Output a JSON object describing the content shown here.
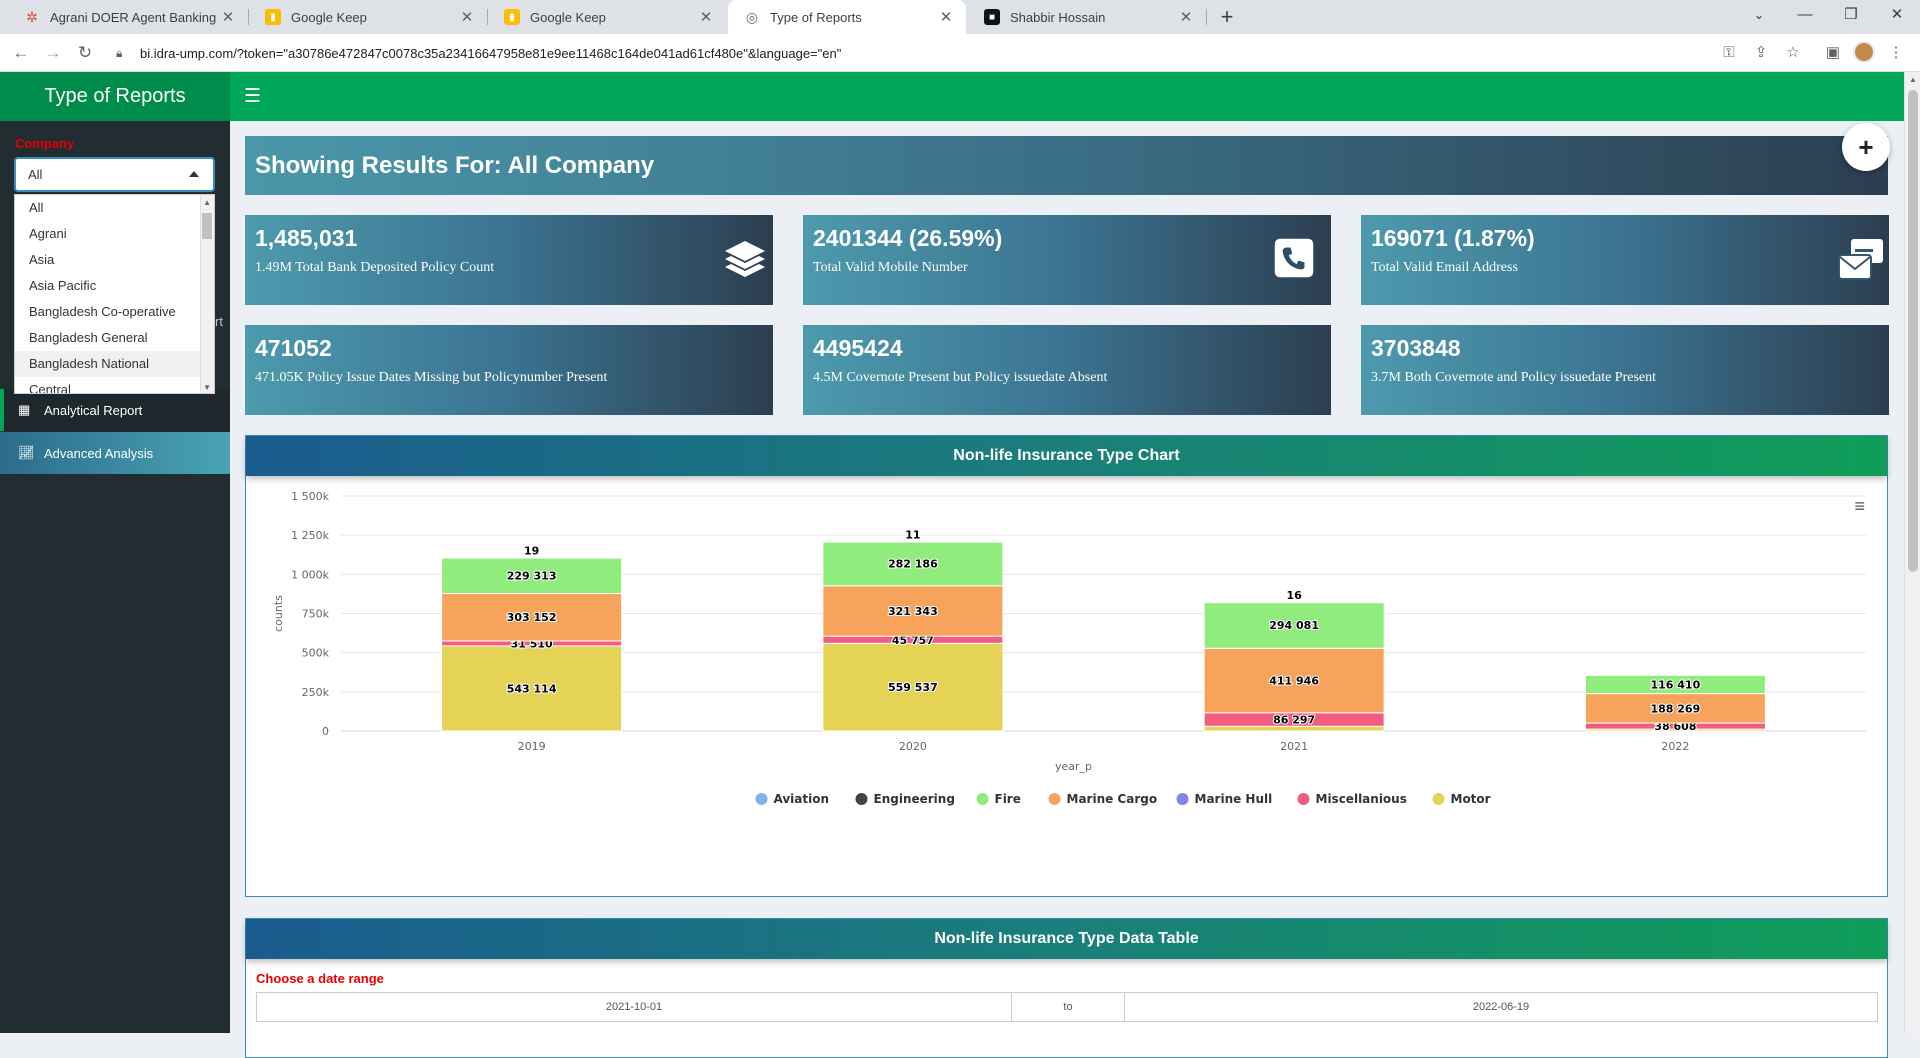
{
  "browser": {
    "tabs": [
      {
        "title": "Agrani DOER Agent Banking Ana",
        "close": "✕"
      },
      {
        "title": "Google Keep",
        "close": "✕"
      },
      {
        "title": "Google Keep",
        "close": "✕"
      },
      {
        "title": "Type of Reports",
        "close": "✕"
      },
      {
        "title": "Shabbir Hossain",
        "close": "✕"
      }
    ],
    "url": "bi.idra-ump.com/?token=\"a30786e472847c0078c35a23416647958e81e9ee11468c164de041ad61cf480e\"&language=\"en\""
  },
  "app": {
    "title": "Type of Reports",
    "accent": "#00a65a"
  },
  "sidebar": {
    "company_label": "Company",
    "selected": "All",
    "options": [
      "All",
      "Agrani",
      "Asia",
      "Asia Pacific",
      "Bangladesh Co-operative",
      "Bangladesh General",
      "Bangladesh National",
      "Central"
    ],
    "partial_text": "rt",
    "menu": [
      {
        "label": "Analytical Report"
      },
      {
        "label": "Advanced Analysis"
      }
    ]
  },
  "banner": {
    "title": "Showing Results For: All Company"
  },
  "kpis": [
    {
      "value": "1,485,031",
      "label": "1.49M Total Bank Deposited Policy Count",
      "icon": "layers-icon"
    },
    {
      "value": "2401344 (26.59%)",
      "label": "Total Valid Mobile Number",
      "icon": "phone-icon"
    },
    {
      "value": "169071 (1.87%)",
      "label": "Total Valid Email Address",
      "icon": "envelope-icon"
    },
    {
      "value": "471052",
      "label": "471.05K Policy Issue Dates Missing but Policynumber Present"
    },
    {
      "value": "4495424",
      "label": "4.5M Covernote Present but Policy issuedate Absent"
    },
    {
      "value": "3703848",
      "label": "3.7M Both Covernote and Policy issuedate Present"
    }
  ],
  "chart_panel": {
    "title": "Non-life Insurance Type Chart"
  },
  "chart_data": {
    "type": "bar",
    "stacked": true,
    "categories": [
      "2019",
      "2020",
      "2021",
      "2022"
    ],
    "xlabel": "year_p",
    "ylabel": "counts",
    "ylim": [
      0,
      1500000
    ],
    "yticks": [
      0,
      250000,
      500000,
      750000,
      1000000,
      1250000,
      1500000
    ],
    "yticklabels": [
      "0",
      "250k",
      "500k",
      "750k",
      "1 000k",
      "1 250k",
      "1 500k"
    ],
    "legend_position": "bottom",
    "series": [
      {
        "name": "Aviation",
        "color": "#7cb5ec",
        "values": [
          0,
          0,
          0,
          0
        ],
        "labels": [
          "",
          "",
          "",
          ""
        ]
      },
      {
        "name": "Engineering",
        "color": "#434348",
        "values": [
          19,
          11,
          16,
          0
        ],
        "labels": [
          "19",
          "11",
          "16",
          ""
        ]
      },
      {
        "name": "Fire",
        "color": "#90ed7d",
        "values": [
          229313,
          282186,
          294081,
          116410
        ],
        "labels": [
          "229 313",
          "282 186",
          "294 081",
          "116 410"
        ]
      },
      {
        "name": "Marine Cargo",
        "color": "#f7a35c",
        "values": [
          303152,
          321343,
          411946,
          188269
        ],
        "labels": [
          "303 152",
          "321 343",
          "411 946",
          "188 269"
        ]
      },
      {
        "name": "Marine Hull",
        "color": "#8085e9",
        "values": [
          0,
          0,
          0,
          0
        ],
        "labels": [
          "",
          "",
          "",
          ""
        ]
      },
      {
        "name": "Miscellanious",
        "color": "#f15c80",
        "values": [
          31510,
          45757,
          86297,
          38608
        ],
        "labels": [
          "31 510",
          "45 757",
          "86 297",
          "38 608"
        ]
      },
      {
        "name": "Motor",
        "color": "#e4d354",
        "values": [
          543114,
          559537,
          30000,
          12000
        ],
        "labels": [
          "543 114",
          "559 537",
          "",
          ""
        ]
      }
    ]
  },
  "table_panel": {
    "title": "Non-life Insurance Type Data Table",
    "date_label": "Choose a date range",
    "start": "2021-10-01",
    "separator": "to",
    "end": "2022-06-19"
  }
}
